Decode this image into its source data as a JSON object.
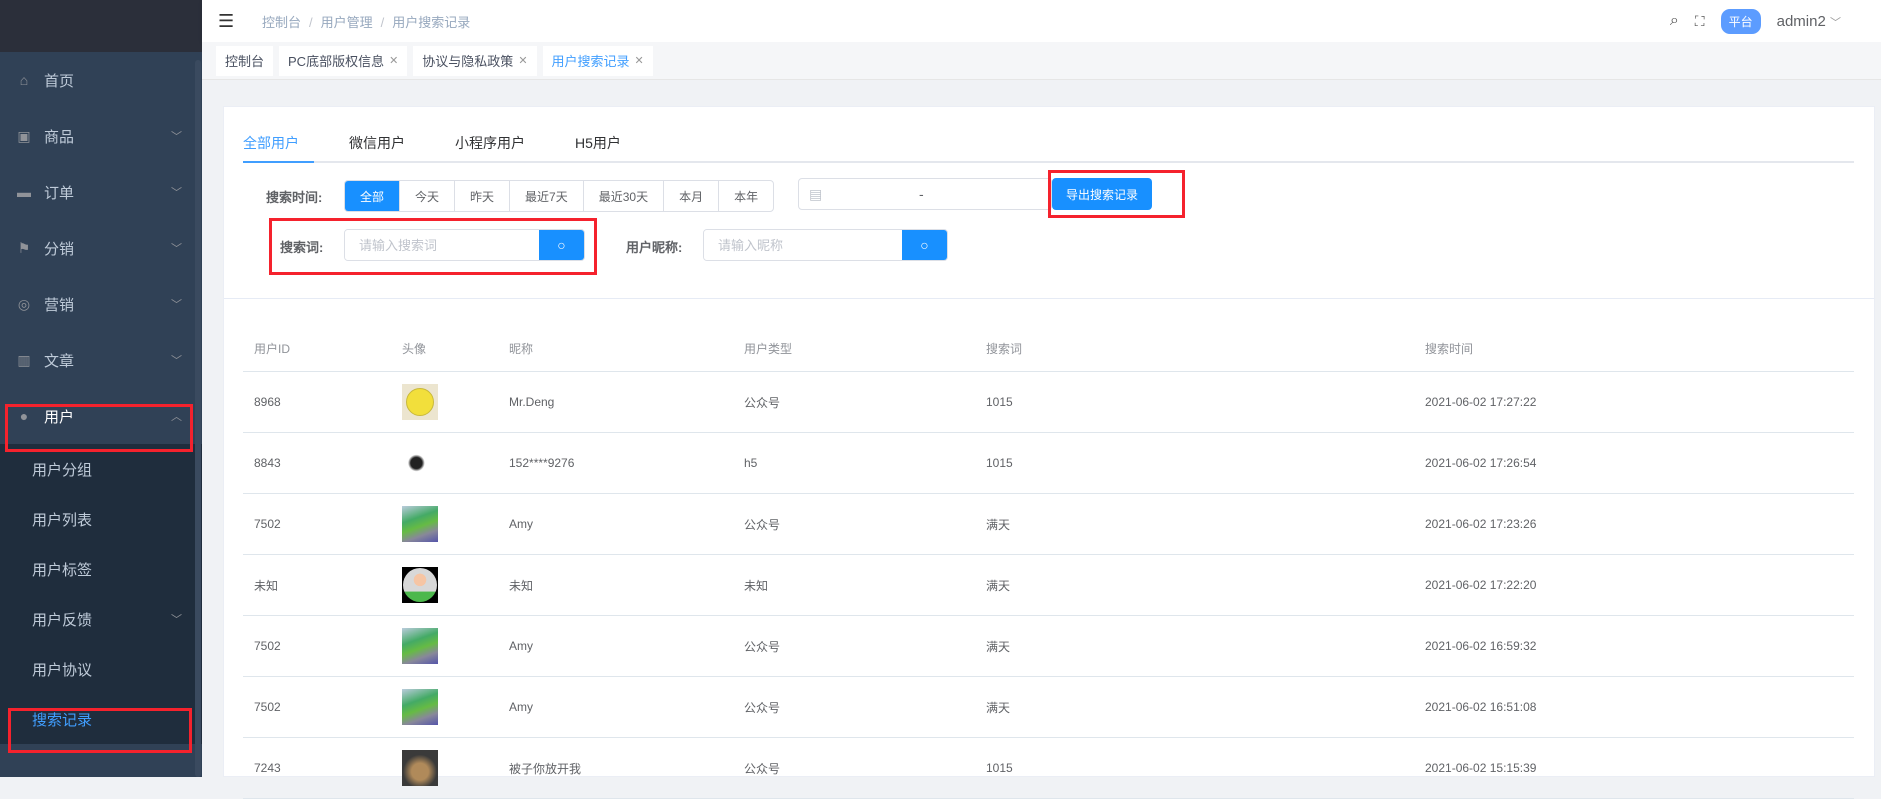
{
  "sidebar": {
    "items": [
      {
        "label": "首页",
        "icon": "home-icon",
        "chevron": ""
      },
      {
        "label": "商品",
        "icon": "shopping-bag-icon",
        "chevron": "﹀"
      },
      {
        "label": "订单",
        "icon": "briefcase-icon",
        "chevron": "﹀"
      },
      {
        "label": "分销",
        "icon": "flag-icon",
        "chevron": "﹀"
      },
      {
        "label": "营销",
        "icon": "lifebuoy-icon",
        "chevron": "﹀"
      },
      {
        "label": "文章",
        "icon": "book-icon",
        "chevron": "﹀"
      },
      {
        "label": "用户",
        "icon": "user-icon",
        "chevron": "︿"
      }
    ],
    "sub_items": [
      {
        "label": "用户分组"
      },
      {
        "label": "用户列表"
      },
      {
        "label": "用户标签"
      },
      {
        "label": "用户反馈",
        "chevron": "﹀"
      },
      {
        "label": "用户协议"
      },
      {
        "label": "搜索记录"
      }
    ]
  },
  "header": {
    "breadcrumb": [
      "控制台",
      "用户管理",
      "用户搜索记录"
    ],
    "separator": "/",
    "platform_badge": "平台",
    "username": "admin2"
  },
  "tags": [
    {
      "label": "控制台",
      "closable": false
    },
    {
      "label": "PC底部版权信息",
      "closable": true
    },
    {
      "label": "协议与隐私政策",
      "closable": true
    },
    {
      "label": "用户搜索记录",
      "closable": true
    }
  ],
  "tabs": [
    "全部用户",
    "微信用户",
    "小程序用户",
    "H5用户"
  ],
  "filters": {
    "time_label": "搜索时间:",
    "time_options": [
      "全部",
      "今天",
      "昨天",
      "最近7天",
      "最近30天",
      "本月",
      "本年"
    ],
    "date_separator": "-",
    "export_button": "导出搜索记录",
    "keyword_label": "搜索词:",
    "keyword_placeholder": "请输入搜索词",
    "nickname_label": "用户昵称:",
    "nickname_placeholder": "请输入昵称"
  },
  "table": {
    "columns": [
      "用户ID",
      "头像",
      "昵称",
      "用户类型",
      "搜索词",
      "搜索时间"
    ],
    "rows": [
      {
        "id": "8968",
        "avatar": "smile",
        "nickname": "Mr.Deng",
        "type": "公众号",
        "keyword": "1015",
        "time": "2021-06-02 17:27:22"
      },
      {
        "id": "8843",
        "avatar": "bird",
        "nickname": "152****9276",
        "type": "h5",
        "keyword": "1015",
        "time": "2021-06-02 17:26:54"
      },
      {
        "id": "7502",
        "avatar": "garden",
        "nickname": "Amy",
        "type": "公众号",
        "keyword": "满天",
        "time": "2021-06-02 17:23:26"
      },
      {
        "id": "未知",
        "avatar": "person",
        "nickname": "未知",
        "type": "未知",
        "keyword": "满天",
        "time": "2021-06-02 17:22:20"
      },
      {
        "id": "7502",
        "avatar": "garden",
        "nickname": "Amy",
        "type": "公众号",
        "keyword": "满天",
        "time": "2021-06-02 16:59:32"
      },
      {
        "id": "7502",
        "avatar": "garden",
        "nickname": "Amy",
        "type": "公众号",
        "keyword": "满天",
        "time": "2021-06-02 16:51:08"
      },
      {
        "id": "7243",
        "avatar": "cat",
        "nickname": "被子你放开我",
        "type": "公众号",
        "keyword": "1015",
        "time": "2021-06-02 15:15:39"
      }
    ]
  }
}
